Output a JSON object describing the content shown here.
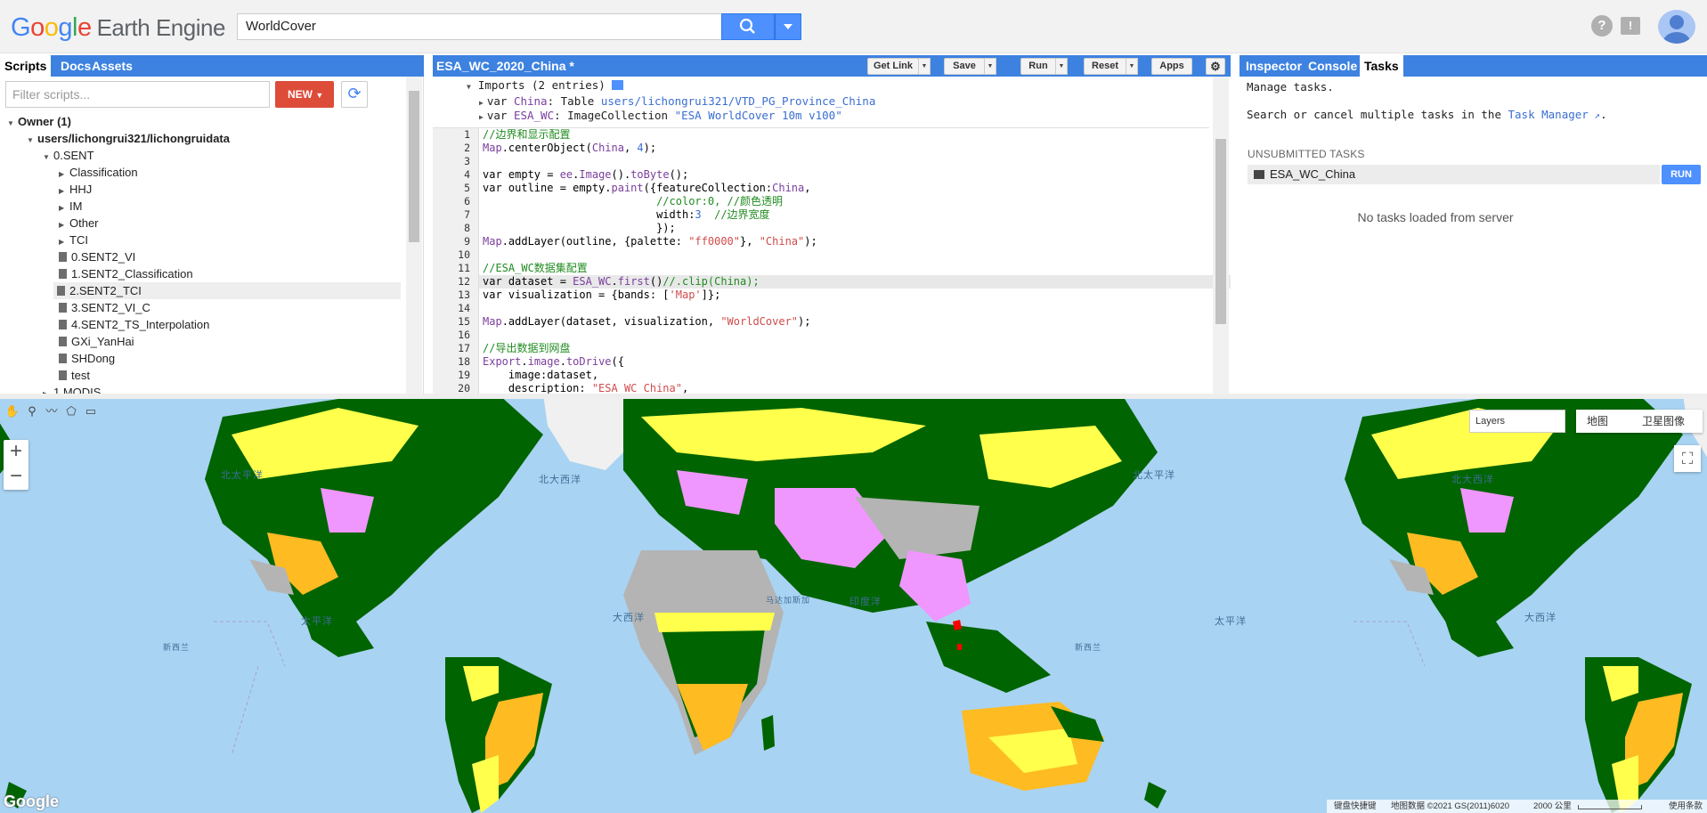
{
  "header": {
    "logo_google": [
      "G",
      "o",
      "o",
      "g",
      "l",
      "e"
    ],
    "logo_rest": "Earth Engine",
    "search_value": "WorldCover"
  },
  "left_panel": {
    "tabs": [
      "Scripts",
      "Docs",
      "Assets"
    ],
    "filter_placeholder": "Filter scripts...",
    "new_label": "NEW",
    "tree": [
      {
        "label": "Owner (1)",
        "depth": 0,
        "kind": "folder-open",
        "bold": true
      },
      {
        "label": "users/lichongrui321/lichongruidata",
        "depth": 1,
        "kind": "folder-open",
        "bold": true
      },
      {
        "label": "0.SENT",
        "depth": 2,
        "kind": "folder-open"
      },
      {
        "label": "Classification",
        "depth": 3,
        "kind": "folder"
      },
      {
        "label": "HHJ",
        "depth": 3,
        "kind": "folder"
      },
      {
        "label": "IM",
        "depth": 3,
        "kind": "folder"
      },
      {
        "label": "Other",
        "depth": 3,
        "kind": "folder"
      },
      {
        "label": "TCI",
        "depth": 3,
        "kind": "folder"
      },
      {
        "label": "0.SENT2_VI",
        "depth": 3,
        "kind": "file"
      },
      {
        "label": "1.SENT2_Classification",
        "depth": 3,
        "kind": "file"
      },
      {
        "label": "2.SENT2_TCI",
        "depth": 3,
        "kind": "file",
        "selected": true
      },
      {
        "label": "3.SENT2_VI_C",
        "depth": 3,
        "kind": "file"
      },
      {
        "label": "4.SENT2_TS_Interpolation",
        "depth": 3,
        "kind": "file"
      },
      {
        "label": "GXi_YanHai",
        "depth": 3,
        "kind": "file"
      },
      {
        "label": "SHDong",
        "depth": 3,
        "kind": "file"
      },
      {
        "label": "test",
        "depth": 3,
        "kind": "file"
      },
      {
        "label": "1.MODIS",
        "depth": 2,
        "kind": "folder"
      }
    ]
  },
  "editor": {
    "title": "ESA_WC_2020_China *",
    "buttons": {
      "get_link": "Get Link",
      "save": "Save",
      "run": "Run",
      "reset": "Reset",
      "apps": "Apps"
    },
    "imports_header": "Imports (2 entries)",
    "imports": [
      {
        "var": "China",
        "type": "Table",
        "value": "users/lichongrui321/VTD_PG_Province_China"
      },
      {
        "var": "ESA_WC",
        "type": "ImageCollection",
        "value": "\"ESA WorldCover 10m v100\""
      }
    ],
    "lines": [
      "1",
      "2",
      "3",
      "4",
      "5",
      "6",
      "7",
      "8",
      "9",
      "10",
      "11",
      "12",
      "13",
      "14",
      "15",
      "16",
      "17",
      "18",
      "19",
      "20"
    ]
  },
  "right_panel": {
    "tabs": [
      "Inspector",
      "Console",
      "Tasks"
    ],
    "manage": "Manage tasks.",
    "search_text": "Search or cancel multiple tasks in the ",
    "task_manager_link": "Task Manager",
    "unsubmitted": "UNSUBMITTED TASKS",
    "task_name": "ESA_WC_China",
    "run_label": "RUN",
    "no_tasks": "No tasks loaded from server"
  },
  "map": {
    "ocean_labels": [
      "北太平洋",
      "北大西洋",
      "太平洋",
      "大西洋",
      "印度洋",
      "北太平洋",
      "北大西洋",
      "太平洋",
      "大西洋",
      "新西兰",
      "新西兰",
      "马达加斯加"
    ],
    "layers_label": "Layers",
    "map_type": [
      "地图",
      "卫星图像"
    ],
    "google_mark": "Google",
    "attribution": [
      "键盘快捷键",
      "地图数据 ©2021 GS(2011)6020",
      "2000 公里",
      "使用条款"
    ],
    "landcover_colors": {
      "tree": "#006400",
      "grass": "#ffff4c",
      "shrub": "#ffbb22",
      "crop": "#f096ff",
      "bare": "#b4b4b4",
      "snow": "#f0f0f0",
      "water": "#0064c8",
      "ocean": "#a9d3f2"
    }
  }
}
